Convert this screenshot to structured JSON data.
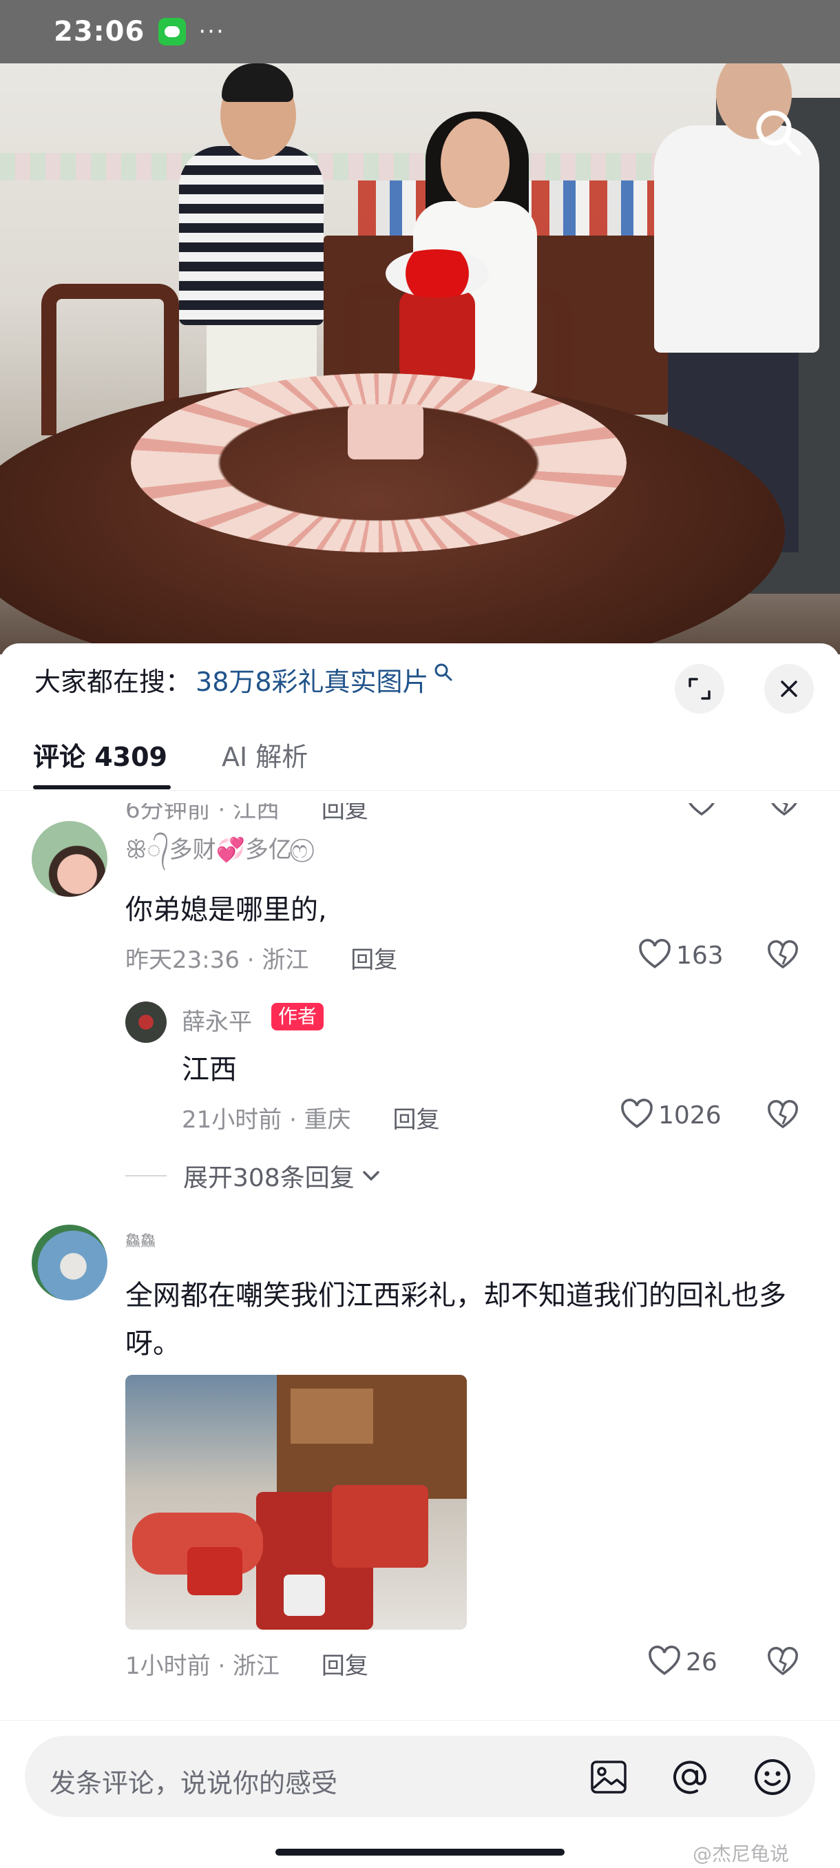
{
  "status_bar": {
    "time": "23:06",
    "dots": "···"
  },
  "search_bar": {
    "label": "大家都在搜：",
    "query": "38万8彩礼真实图片"
  },
  "tabs": {
    "comments": "评论 4309",
    "ai": "AI 解析"
  },
  "cut_comment": {
    "time": "6分钟前 · 江西",
    "reply": "回复"
  },
  "comments": [
    {
      "nickname": "ꕥ᭄多财💞多亿ෆ⃝",
      "text": "你弟媳是哪里的,",
      "time": "昨天23:36 · 浙江",
      "reply": "回复",
      "likes": "163"
    },
    {
      "nickname": "鱻鱻",
      "text": "全网都在嘲笑我们江西彩礼，却不知道我们的回礼也多呀。",
      "time": "1小时前 · 浙江",
      "reply": "回复",
      "likes": "26"
    }
  ],
  "author_reply": {
    "nickname": "薛永平",
    "badge": "作者",
    "text": "江西",
    "time": "21小时前 · 重庆",
    "reply": "回复",
    "likes": "1026"
  },
  "expand_replies": "展开308条回复",
  "input": {
    "placeholder": "发条评论，说说你的感受"
  },
  "watermark": "@杰尼龟说",
  "icons": {
    "search": "search-icon",
    "expand": "expand-icon",
    "close": "close-icon",
    "like": "heart-icon",
    "dislike": "broken-heart-icon",
    "image": "image-icon",
    "mention": "at-icon",
    "emoji": "emoji-icon"
  },
  "colors": {
    "link": "#20538a",
    "badge": "#fe2c55",
    "muted": "#8f9096"
  }
}
